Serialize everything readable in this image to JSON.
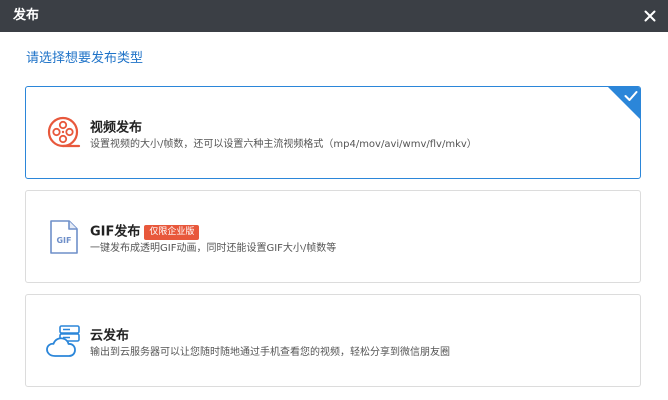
{
  "window": {
    "title": "发布",
    "close_icon": "close-icon"
  },
  "subtitle": "请选择想要发布类型",
  "colors": {
    "titlebar": "#3b3f45",
    "accent": "#2b86d9",
    "video_icon": "#e8583c",
    "gif_icon": "#6e8fc9",
    "cloud_icon": "#2b86d9",
    "badge": "#e8583c"
  },
  "options": [
    {
      "id": "video",
      "name": "视频发布",
      "desc": "设置视频的大小/帧数，还可以设置六种主流视频格式（mp4/mov/avi/wmv/flv/mkv）",
      "icon": "film-reel-icon",
      "selected": true
    },
    {
      "id": "gif",
      "name": "GIF发布",
      "badge": "仅限企业版",
      "desc": "一键发布成透明GIF动画，同时还能设置GIF大小/帧数等",
      "icon": "gif-file-icon",
      "icon_text": "GIF",
      "selected": false
    },
    {
      "id": "cloud",
      "name": "云发布",
      "desc": "输出到云服务器可以让您随时随地通过手机查看您的视频，轻松分享到微信朋友圈",
      "icon": "cloud-server-icon",
      "selected": false
    }
  ]
}
